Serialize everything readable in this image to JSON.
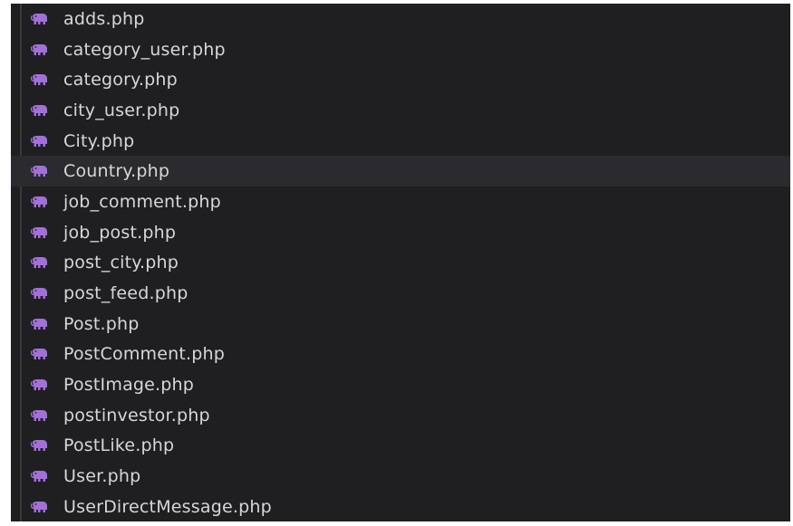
{
  "explorer": {
    "icon": "php-elephant-icon",
    "icon_color": "#a270d8",
    "hover_index": 5,
    "files": [
      {
        "name": "adds.php"
      },
      {
        "name": "category_user.php"
      },
      {
        "name": "category.php"
      },
      {
        "name": "city_user.php"
      },
      {
        "name": "City.php"
      },
      {
        "name": "Country.php"
      },
      {
        "name": "job_comment.php"
      },
      {
        "name": "job_post.php"
      },
      {
        "name": "post_city.php"
      },
      {
        "name": "post_feed.php"
      },
      {
        "name": "Post.php"
      },
      {
        "name": "PostComment.php"
      },
      {
        "name": "PostImage.php"
      },
      {
        "name": "postinvestor.php"
      },
      {
        "name": "PostLike.php"
      },
      {
        "name": "User.php"
      },
      {
        "name": "UserDirectMessage.php"
      }
    ]
  }
}
